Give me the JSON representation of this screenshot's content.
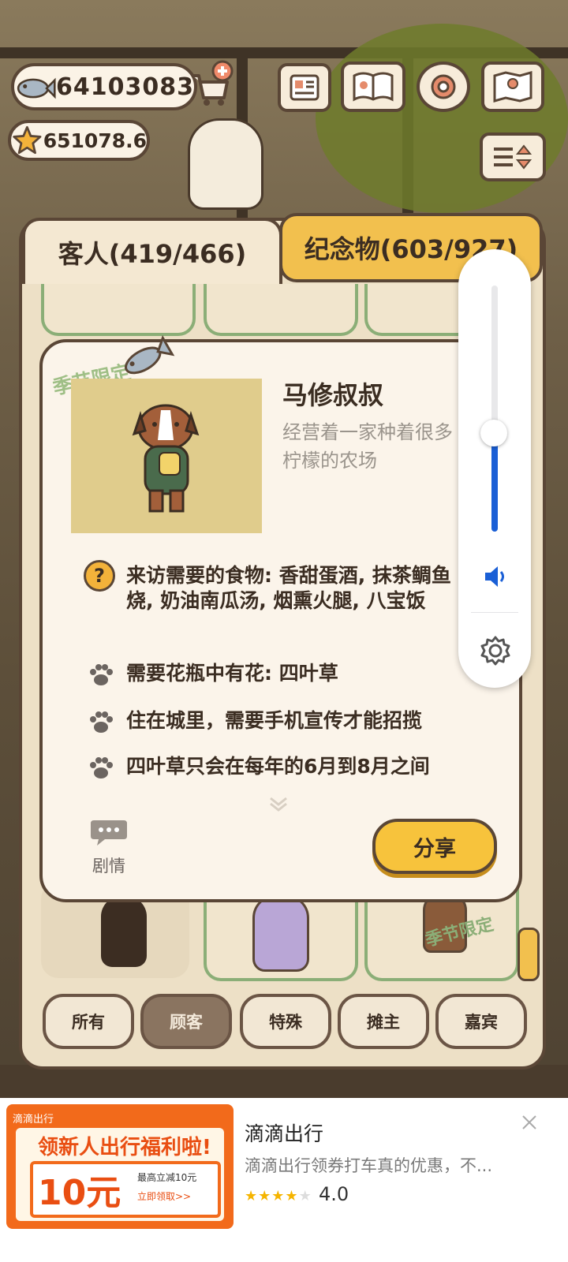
{
  "currency": {
    "fish": "64103083",
    "stars": "651078.6"
  },
  "tabs": [
    {
      "label": "客人(419/466)"
    },
    {
      "label": "纪念物(603/927)"
    }
  ],
  "guest": {
    "badge": "季节限定",
    "name": "马修叔叔",
    "description": "经营着一家种着很多柠檬的农场",
    "requirements": [
      "来访需要的食物: 香甜蛋酒, 抹茶鲷鱼烧, 奶油南瓜汤, 烟熏火腿, 八宝饭",
      "需要花瓶中有花: 四叶草",
      "住在城里，需要手机宣传才能招揽",
      "四叶草只会在每年的6月到8月之间"
    ],
    "story_label": "剧情",
    "share_label": "分享",
    "card_badge": "季节限定"
  },
  "filters": [
    "所有",
    "顾客",
    "特殊",
    "摊主",
    "嘉宾"
  ],
  "selected_filter": "顾客",
  "volume": {
    "level": 0.4
  },
  "ad": {
    "brand_small": "滴滴出行",
    "banner_headline": "领新人出行福利啦!",
    "banner_amount": "10元",
    "banner_sub": "最高立减10元",
    "banner_cta": "立即领取>>",
    "title": "滴滴出行",
    "description": "滴滴出行领券打车真的优惠，不...",
    "rating": "4.0",
    "stars": 4
  },
  "colors": {
    "panel": "#ede0c6",
    "popup": "#fbf4ea",
    "outline": "#5a4636",
    "tab_inactive": "#f2c04e",
    "share": "#f7c33c",
    "card_border": "#8bae77",
    "volume_accent": "#1a5fd6",
    "ad_orange": "#f26a1b"
  }
}
